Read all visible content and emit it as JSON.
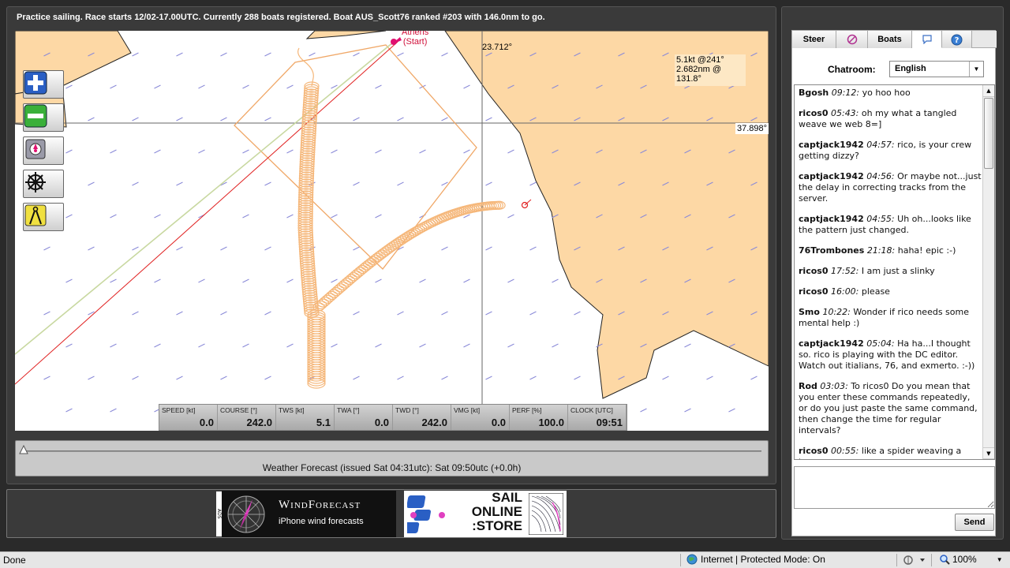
{
  "status_bar": "Practice sailing. Race starts 12/02-17.00UTC. Currently 288 boats registered. Boat AUS_Scott76 ranked #203 with 146.0nm to go.",
  "map": {
    "lon_readout": "23.712°",
    "lat_readout": "37.898°",
    "wind_line1": "5.1kt @241°",
    "wind_line2": "2.682nm @ 131.8°",
    "start_line1": "Athens",
    "start_line2": "(Start)",
    "land_color": "#fdd8a5",
    "track_color": "#f5b77a"
  },
  "tools": [
    {
      "name": "zoom-in-icon"
    },
    {
      "name": "zoom-out-icon"
    },
    {
      "name": "center-boat-icon"
    },
    {
      "name": "helm-icon"
    },
    {
      "name": "compass-divider-icon"
    }
  ],
  "instruments": [
    {
      "label": "SPEED [kt]",
      "value": "0.0"
    },
    {
      "label": "COURSE [°]",
      "value": "242.0"
    },
    {
      "label": "TWS [kt]",
      "value": "5.1"
    },
    {
      "label": "TWA [°]",
      "value": "0.0"
    },
    {
      "label": "TWD [°]",
      "value": "242.0"
    },
    {
      "label": "VMG [kt]",
      "value": "0.0"
    },
    {
      "label": "PERF [%]",
      "value": "100.0"
    },
    {
      "label": "CLOCK [UTC]",
      "value": "09:51"
    }
  ],
  "forecast": "Weather Forecast  (issued Sat 04:31utc): Sat 09:50utc  (+0.0h)",
  "ads": {
    "tag": "ADS",
    "wind_title": "WindForecast",
    "wind_sub": "iPhone wind forecasts",
    "sail_line1": "SAIL",
    "sail_line2": "ONLINE",
    "sail_line3": ":STORE"
  },
  "tabs": {
    "steer": "Steer",
    "boats": "Boats"
  },
  "chat": {
    "room_label": "Chatroom:",
    "room_value": "English",
    "send_label": "Send",
    "messages": [
      {
        "user": "Bgosh",
        "time": "09:12:",
        "text": "yo hoo hoo"
      },
      {
        "user": "ricos0",
        "time": "05:43:",
        "text": "oh my what a tangled weave we web 8=]"
      },
      {
        "user": "captjack1942",
        "time": "04:57:",
        "text": "rico, is your crew getting dizzy?"
      },
      {
        "user": "captjack1942",
        "time": "04:56:",
        "text": "Or maybe not...just the delay in correcting tracks from the server."
      },
      {
        "user": "captjack1942",
        "time": "04:55:",
        "text": "Uh oh...looks like the pattern just changed."
      },
      {
        "user": "76Trombones",
        "time": "21:18:",
        "text": "haha! epic :-)"
      },
      {
        "user": "ricos0",
        "time": "17:52:",
        "text": "I am just a slinky"
      },
      {
        "user": "ricos0",
        "time": "16:00:",
        "text": "please"
      },
      {
        "user": "Smo",
        "time": "10:22:",
        "text": "Wonder if rico needs some mental help :)"
      },
      {
        "user": "captjack1942",
        "time": "05:04:",
        "text": "Ha ha...I thought so. rico is playing with the DC editor. Watch out itialians, 76, and exmerto.   :-))"
      },
      {
        "user": "Rod",
        "time": "03:03:",
        "text": "To ricos0  Do you mean that you enter these commands repeatedly, or do you just paste the same command, then change the time for regular intervals?"
      },
      {
        "user": "ricos0",
        "time": "00:55:",
        "text": "like a spider weaving a trap"
      }
    ]
  },
  "browser_status": {
    "done": "Done",
    "zone": "Internet | Protected Mode: On",
    "zoom": "100%"
  }
}
